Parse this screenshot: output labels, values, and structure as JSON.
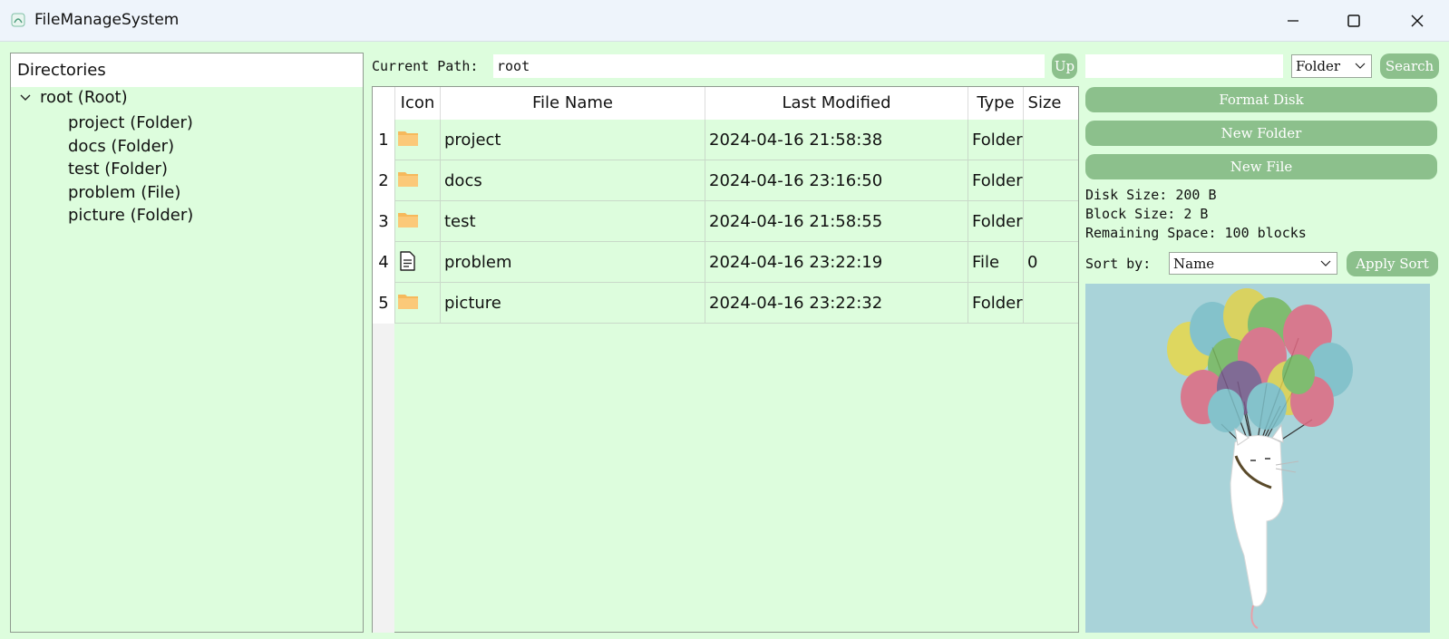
{
  "window": {
    "title": "FileManageSystem",
    "minimize_icon": "minimize-icon",
    "maximize_icon": "maximize-icon",
    "close_icon": "close-icon"
  },
  "tree": {
    "header": "Directories",
    "root_label": "root (Root)",
    "children": [
      "project (Folder)",
      "docs (Folder)",
      "test (Folder)",
      "problem (File)",
      "picture (Folder)"
    ]
  },
  "path": {
    "label": "Current Path:",
    "value": "root",
    "up_label": "Up"
  },
  "table": {
    "columns": [
      "Icon",
      "File Name",
      "Last Modified",
      "Type",
      "Size"
    ],
    "rows": [
      {
        "num": "1",
        "icon": "folder-icon",
        "name": "project",
        "modified": "2024-04-16 21:58:38",
        "type": "Folder",
        "size": ""
      },
      {
        "num": "2",
        "icon": "folder-icon",
        "name": "docs",
        "modified": "2024-04-16 23:16:50",
        "type": "Folder",
        "size": ""
      },
      {
        "num": "3",
        "icon": "folder-icon",
        "name": "test",
        "modified": "2024-04-16 21:58:55",
        "type": "Folder",
        "size": ""
      },
      {
        "num": "4",
        "icon": "file-icon",
        "name": "problem",
        "modified": "2024-04-16 23:22:19",
        "type": "File",
        "size": "0"
      },
      {
        "num": "5",
        "icon": "folder-icon",
        "name": "picture",
        "modified": "2024-04-16 23:22:32",
        "type": "Folder",
        "size": ""
      }
    ]
  },
  "search": {
    "value": "",
    "type_selected": "Folder",
    "button_label": "Search"
  },
  "actions": {
    "format_label": "Format Disk",
    "new_folder_label": "New Folder",
    "new_file_label": "New File"
  },
  "disk_info": {
    "disk_size": "Disk Size: 200 B",
    "block_size": "Block Size: 2 B",
    "remaining": "Remaining Space: 100 blocks"
  },
  "sort": {
    "label": "Sort by:",
    "selected": "Name",
    "apply_label": "Apply Sort"
  },
  "picture": {
    "subject": "cat-with-balloons-illustration"
  },
  "colors": {
    "background": "#ddfddd",
    "button": "#8cc08c",
    "folder": "#f6b95c"
  }
}
